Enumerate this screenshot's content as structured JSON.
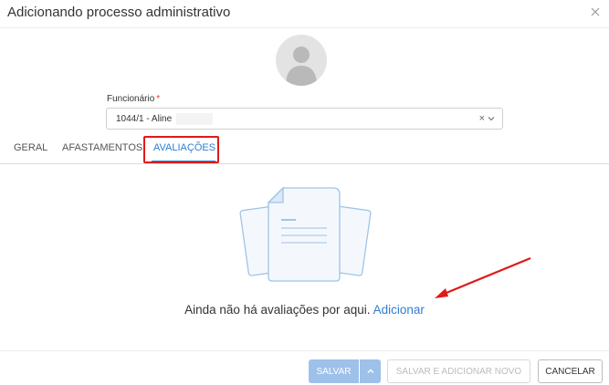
{
  "modal": {
    "title": "Adicionando processo administrativo"
  },
  "form": {
    "employee_label": "Funcionário",
    "required_mark": "*",
    "employee_value": "1044/1 - Aline",
    "clear_symbol": "×"
  },
  "tabs": [
    {
      "label": "GERAL"
    },
    {
      "label": "AFASTAMENTOS"
    },
    {
      "label": "AVALIAÇÕES"
    }
  ],
  "empty_state": {
    "message": "Ainda não há avaliações por aqui.",
    "action": "Adicionar"
  },
  "footer": {
    "save": "SALVAR",
    "save_and_new": "SALVAR E ADICIONAR NOVO",
    "cancel": "CANCELAR"
  },
  "colors": {
    "accent": "#2f7fcf",
    "annotation": "#e01919",
    "save_disabled": "#9ec1ea"
  }
}
